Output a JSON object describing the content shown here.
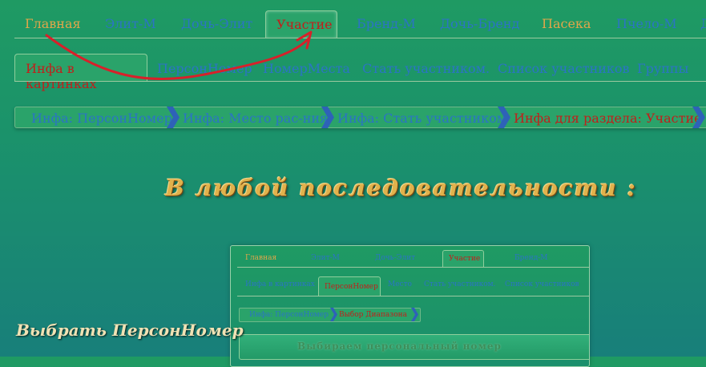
{
  "top_nav": {
    "items": [
      "Главная",
      "Элит-М",
      "Дочь-Элит",
      "Участие",
      "Бренд-М",
      "Дочь-Бренд",
      "Пасека",
      "Пчело-М",
      "Д"
    ],
    "active_index": 3
  },
  "sub_nav": {
    "items": [
      "Инфа в картинках",
      "ПерсонНомер",
      "НомерМеста",
      "Стать участником.",
      "Список участников",
      "Группы"
    ],
    "active_index": 0
  },
  "breadcrumbs": {
    "items": [
      "Инфа: ПерсонНомер",
      "Инфа: Место рас-ния",
      "Инфа: Стать участником",
      "Инфа для раздела: Участие"
    ],
    "active_index": 3
  },
  "heading": "В любой последовательности :",
  "caption": "Выбрать ПерсонНомер",
  "thumbnail": {
    "top_nav": [
      "Главная",
      "Элит-М",
      "Дочь-Элит",
      "Участие",
      "Бренд-М"
    ],
    "sub_nav": [
      "Инфа в картинках",
      "ПерсонНомер",
      "Место",
      "Стать участником.",
      "Список участников"
    ],
    "crumbs": [
      "Инфа: ПерсонНомер",
      "Выбор Диапазона"
    ],
    "bar_text": "Выбираем персональный номер"
  },
  "colors": {
    "active_text": "#c0201b",
    "link_text": "#2b74c4",
    "gold_text": "#e0a64a",
    "arrow": "#d8202a"
  }
}
